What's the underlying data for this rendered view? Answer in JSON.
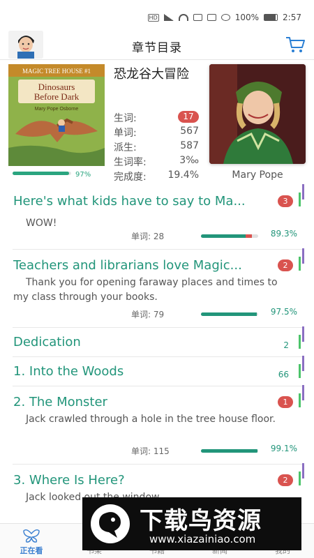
{
  "status_bar": {
    "battery": "100%",
    "time": "2:57"
  },
  "header": {
    "title": "章节目录"
  },
  "book": {
    "cover": {
      "series_line": "MAGIC TREE HOUSE #1",
      "title_line1": "Dinosaurs",
      "title_line2": "Before Dark",
      "author": "Mary Pope Osborne"
    },
    "title": "恐龙谷大冒险",
    "progress_label": "97%",
    "progress_value": 0.97,
    "stats": [
      {
        "label": "生词:",
        "value": "17"
      },
      {
        "label": "单词:",
        "value": "567"
      },
      {
        "label": "派生:",
        "value": "587"
      },
      {
        "label": "生词率:",
        "value": "3‰"
      },
      {
        "label": "完成度:",
        "value": "19.4%"
      }
    ],
    "author_name": "Mary Pope"
  },
  "chapters": [
    {
      "title": "Here's what kids have to say to Ma...",
      "badge": "3",
      "snippet": "WOW!",
      "words": "单词: 28",
      "pct_label": "89.3%",
      "pct": 0.893
    },
    {
      "title": "Teachers and librarians love Magic...",
      "badge": "2",
      "snippet": "Thank you for opening faraway places and times to my class through your books.",
      "words": "单词: 79",
      "pct_label": "97.5%",
      "pct": 0.975
    },
    {
      "title": "Dedication",
      "count": "2"
    },
    {
      "title": "1. Into the Woods",
      "count": "66"
    },
    {
      "title": "2. The Monster",
      "badge": "1",
      "snippet": "Jack crawled through a hole in the tree house floor.",
      "words": "单词: 115",
      "pct_label": "99.1%",
      "pct": 0.991
    },
    {
      "title": "3. Where Is Here?",
      "badge": "2",
      "snippet": "Jack looked out the window."
    }
  ],
  "bottom_nav": [
    {
      "label": "正在看",
      "active": true
    },
    {
      "label": "书架"
    },
    {
      "label": "书籍"
    },
    {
      "label": "新闻"
    },
    {
      "label": "我的"
    }
  ],
  "watermark": {
    "text": "下载鸟资源",
    "url": "www.xiazainiao.com"
  },
  "colors": {
    "accent": "#22957a",
    "badge": "#d9534f",
    "marker_green": "#4cc46a",
    "marker_purple": "#8b6fc2",
    "nav_active": "#3a7fd0"
  }
}
